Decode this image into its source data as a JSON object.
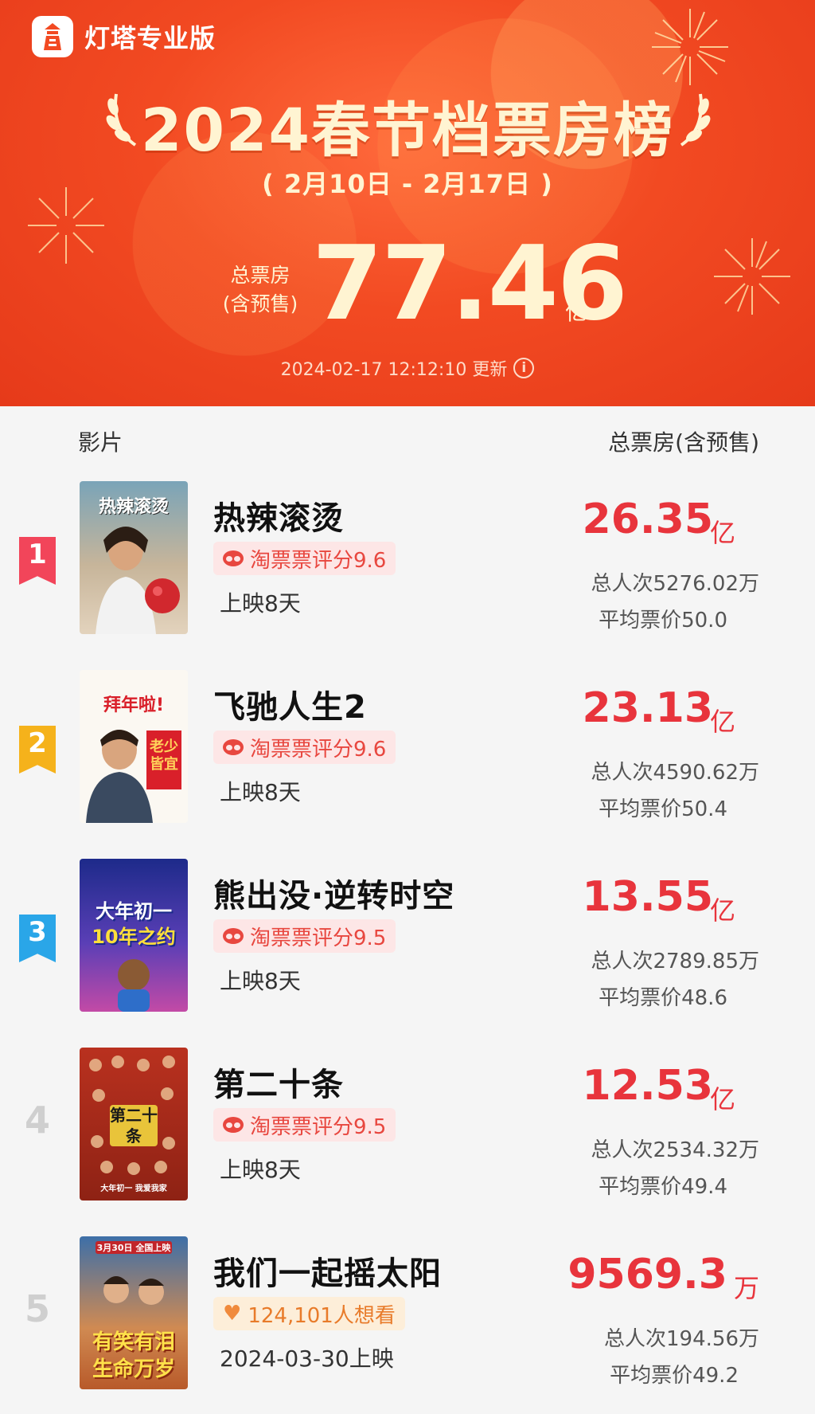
{
  "brand": {
    "name": "灯塔专业版",
    "logo_icon": "lighthouse-icon",
    "color": "#f24a22"
  },
  "header": {
    "title": "2024春节档票房榜",
    "date_range": "( 2月10日 - 2月17日 )",
    "total_label_line1": "总票房",
    "total_label_line2": "(含预售)",
    "total_value": "77.46",
    "total_unit": "亿",
    "update_text": "2024-02-17 12:12:10 更新",
    "info_icon": "i"
  },
  "columns": {
    "film": "影片",
    "box_office": "总票房(含预售)"
  },
  "colors": {
    "accent": "#e8343c",
    "rank1": "#f2455a",
    "rank2": "#f5b21b",
    "rank3": "#2aa6e8"
  },
  "films": [
    {
      "rank": "1",
      "title": "热辣滚烫",
      "tag": "淘票票评分9.6",
      "status": "上映8天",
      "box_value": "26.35",
      "box_unit": "亿",
      "admissions": "总人次5276.02万",
      "avg_price": "平均票价50.0"
    },
    {
      "rank": "2",
      "title": "飞驰人生2",
      "tag": "淘票票评分9.6",
      "status": "上映8天",
      "box_value": "23.13",
      "box_unit": "亿",
      "admissions": "总人次4590.62万",
      "avg_price": "平均票价50.4"
    },
    {
      "rank": "3",
      "title": "熊出没·逆转时空",
      "tag": "淘票票评分9.5",
      "status": "上映8天",
      "box_value": "13.55",
      "box_unit": "亿",
      "admissions": "总人次2789.85万",
      "avg_price": "平均票价48.6"
    },
    {
      "rank": "4",
      "title": "第二十条",
      "tag": "淘票票评分9.5",
      "status": "上映8天",
      "box_value": "12.53",
      "box_unit": "亿",
      "admissions": "总人次2534.32万",
      "avg_price": "平均票价49.4"
    },
    {
      "rank": "5",
      "title": "我们一起摇太阳",
      "tag": "124,101人想看",
      "status": "2024-03-30上映",
      "box_value": "9569.3",
      "box_unit": "万",
      "admissions": "总人次194.56万",
      "avg_price": "平均票价49.2"
    }
  ],
  "posters": [
    {
      "text": "热辣滚烫"
    },
    {
      "text": "拜年啦!",
      "text2": "老少皆宜"
    },
    {
      "text": "大年初一",
      "text2": "10年之约"
    },
    {
      "text": "第二十条",
      "text2": "大年初一 我爱我家"
    },
    {
      "text": "3月30日 全国上映",
      "text2": "有笑有泪",
      "text3": "生命万岁"
    }
  ]
}
